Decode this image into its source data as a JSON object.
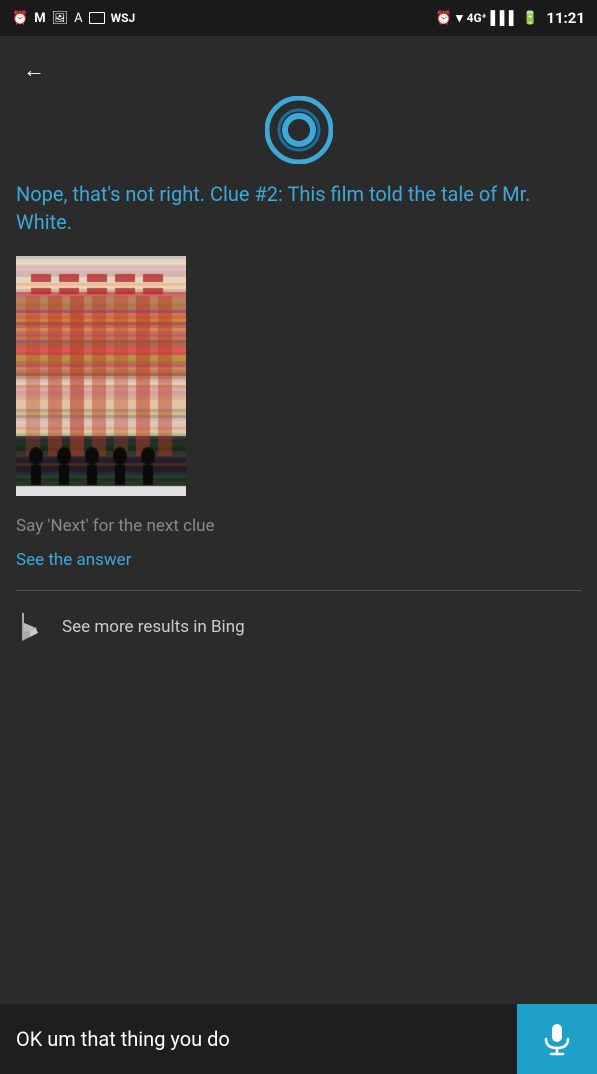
{
  "statusBar": {
    "time": "11:21",
    "leftIcons": [
      "alarm",
      "gmail",
      "image",
      "font-a",
      "square",
      "wsj"
    ],
    "rightIcons": [
      "alarm2",
      "wifi",
      "4g",
      "signal",
      "battery"
    ]
  },
  "header": {
    "backLabel": "←"
  },
  "cortana": {
    "clueText": "Nope, that's not right. Clue #2: This film told the tale of Mr. White.",
    "nextClueText": "Say 'Next' for the next clue",
    "seeAnswerText": "See the answer",
    "bingResultsText": "See more results in Bing"
  },
  "bottomBar": {
    "inputText": "OK um that thing you do",
    "micLabel": "microphone"
  }
}
